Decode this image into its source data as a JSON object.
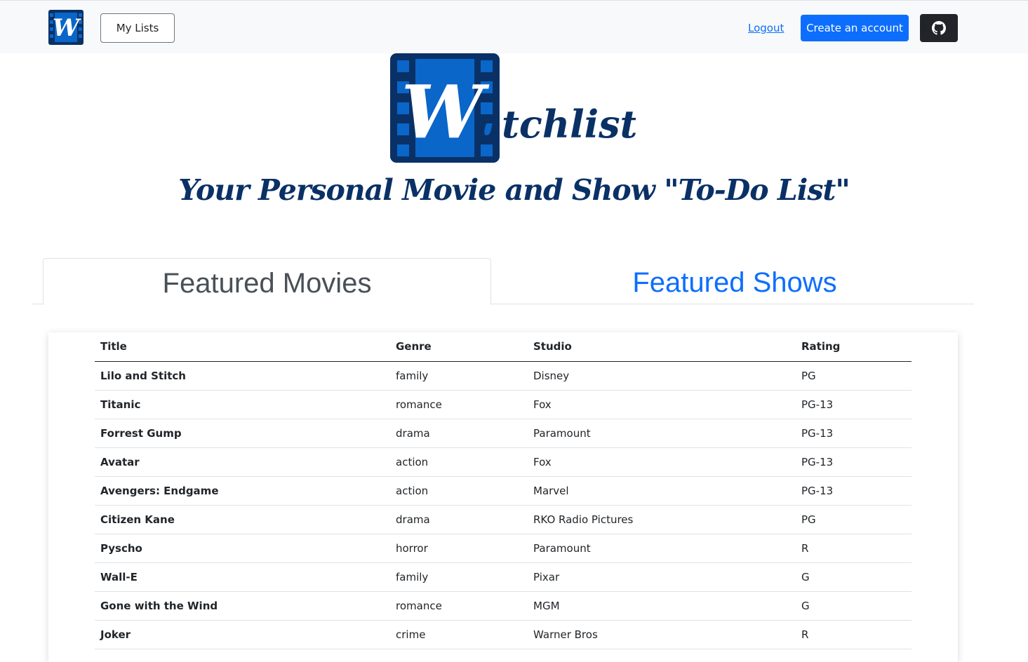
{
  "navbar": {
    "logo_letter": "W",
    "my_lists_label": "My Lists",
    "logout_label": "Logout",
    "create_account_label": "Create an account",
    "github_icon": "github-icon"
  },
  "hero": {
    "logo_letter": "W",
    "logo_suffix": "atchlist",
    "tagline": "Your Personal Movie and Show \"To-Do List\""
  },
  "tabs": [
    {
      "label": "Featured Movies",
      "active": true
    },
    {
      "label": "Featured Shows",
      "active": false
    }
  ],
  "table": {
    "headers": {
      "title": "Title",
      "genre": "Genre",
      "studio": "Studio",
      "rating": "Rating"
    },
    "rows": [
      {
        "title": "Lilo and Stitch",
        "genre": "family",
        "studio": "Disney",
        "rating": "PG"
      },
      {
        "title": "Titanic",
        "genre": "romance",
        "studio": "Fox",
        "rating": "PG-13"
      },
      {
        "title": "Forrest Gump",
        "genre": "drama",
        "studio": "Paramount",
        "rating": "PG-13"
      },
      {
        "title": "Avatar",
        "genre": "action",
        "studio": "Fox",
        "rating": "PG-13"
      },
      {
        "title": "Avengers: Endgame",
        "genre": "action",
        "studio": "Marvel",
        "rating": "PG-13"
      },
      {
        "title": "Citizen Kane",
        "genre": "drama",
        "studio": "RKO Radio Pictures",
        "rating": "PG"
      },
      {
        "title": "Pyscho",
        "genre": "horror",
        "studio": "Paramount",
        "rating": "R"
      },
      {
        "title": "Wall-E",
        "genre": "family",
        "studio": "Pixar",
        "rating": "G"
      },
      {
        "title": "Gone with the Wind",
        "genre": "romance",
        "studio": "MGM",
        "rating": "G"
      },
      {
        "title": "Joker",
        "genre": "crime",
        "studio": "Warner Bros",
        "rating": "R"
      }
    ]
  },
  "colors": {
    "brand_dark_blue": "#0a3166",
    "brand_blue": "#0a66c9",
    "primary": "#0d6efd",
    "navbar_bg": "#f8f9fa",
    "github_btn_bg": "#212529"
  }
}
